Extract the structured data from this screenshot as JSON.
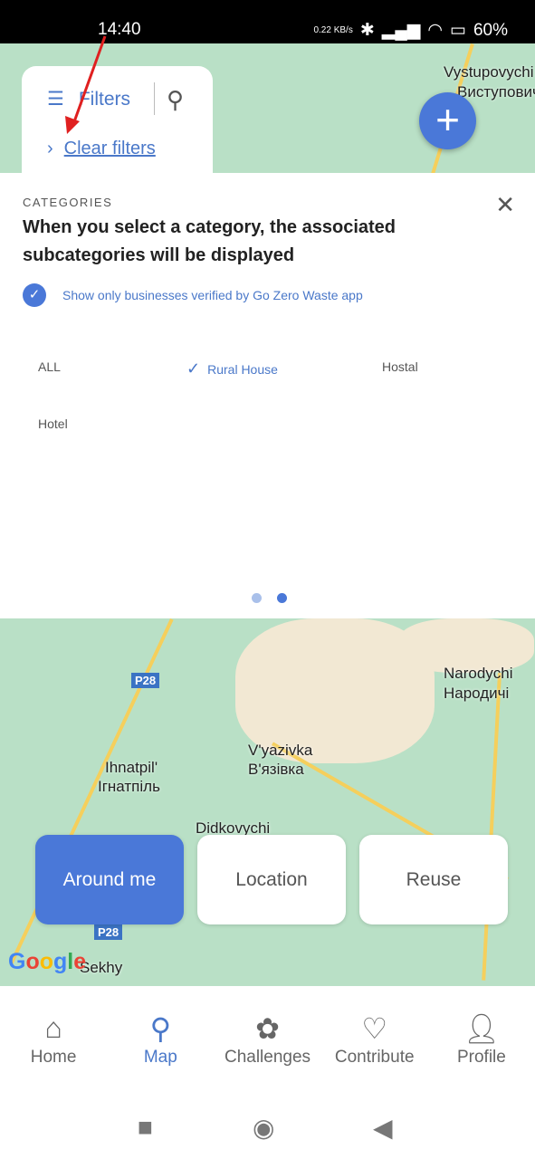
{
  "status": {
    "time": "14:40",
    "net_speed": "0.22 KB/s",
    "battery": "60%"
  },
  "map_top": {
    "labels": [
      "Vystupovychi",
      "Виступовичі"
    ]
  },
  "filters": {
    "label": "Filters",
    "clear": "Clear filters"
  },
  "panel": {
    "category_label": "CATEGORIES",
    "title": "When you select a category, the associated subcategories will be displayed",
    "verified_text": "Show only businesses verified by Go Zero Waste app",
    "items": [
      {
        "label": "ALL",
        "selected": false
      },
      {
        "label": "Rural House",
        "selected": true
      },
      {
        "label": "Hostal",
        "selected": false
      },
      {
        "label": "Hotel",
        "selected": false
      }
    ],
    "page": 2,
    "pages": 2
  },
  "map": {
    "places": [
      "Narodychi",
      "Народичі",
      "V'yazivka",
      "В'язівка",
      "Ihnatpil'",
      "Ігнатпіль",
      "Didkovychi",
      "Sekhy"
    ],
    "road": "P28",
    "attribution": "Google"
  },
  "modes": {
    "items": [
      "Around me",
      "Location",
      "Reuse"
    ],
    "active": "Around me"
  },
  "nav": {
    "items": [
      {
        "label": "Home",
        "icon": "home-icon"
      },
      {
        "label": "Map",
        "icon": "search-icon"
      },
      {
        "label": "Challenges",
        "icon": "badge-icon"
      },
      {
        "label": "Contribute",
        "icon": "heart-icon"
      },
      {
        "label": "Profile",
        "icon": "person-icon"
      }
    ],
    "active": "Map"
  },
  "colors": {
    "accent": "#4a78d8",
    "map_green": "#b9e0c6"
  }
}
